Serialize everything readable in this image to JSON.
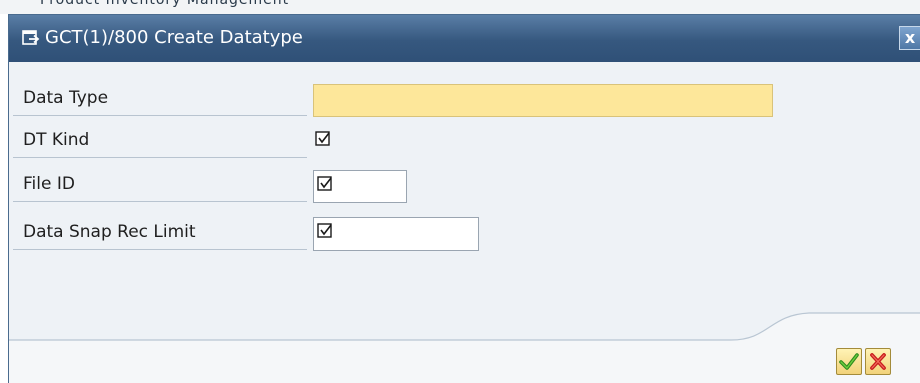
{
  "background": {
    "partial_text": "Product Inventory Management"
  },
  "dialog": {
    "title": "GCT(1)/800 Create Datatype",
    "close_glyph": "x"
  },
  "form": {
    "fields": [
      {
        "label": "Data Type",
        "value": "",
        "required": true
      },
      {
        "label": "DT Kind",
        "value": "",
        "checkbox": true
      },
      {
        "label": "File ID",
        "value": "",
        "checkbox": true
      },
      {
        "label": "Data Snap Rec Limit",
        "value": "",
        "checkbox": true
      }
    ]
  },
  "footer": {
    "ok_icon": "green-checkmark-icon",
    "cancel_icon": "red-x-icon"
  },
  "colors": {
    "titlebar": "#36587f",
    "required_field": "#fde79a",
    "dialog_bg": "#eef2f6"
  }
}
